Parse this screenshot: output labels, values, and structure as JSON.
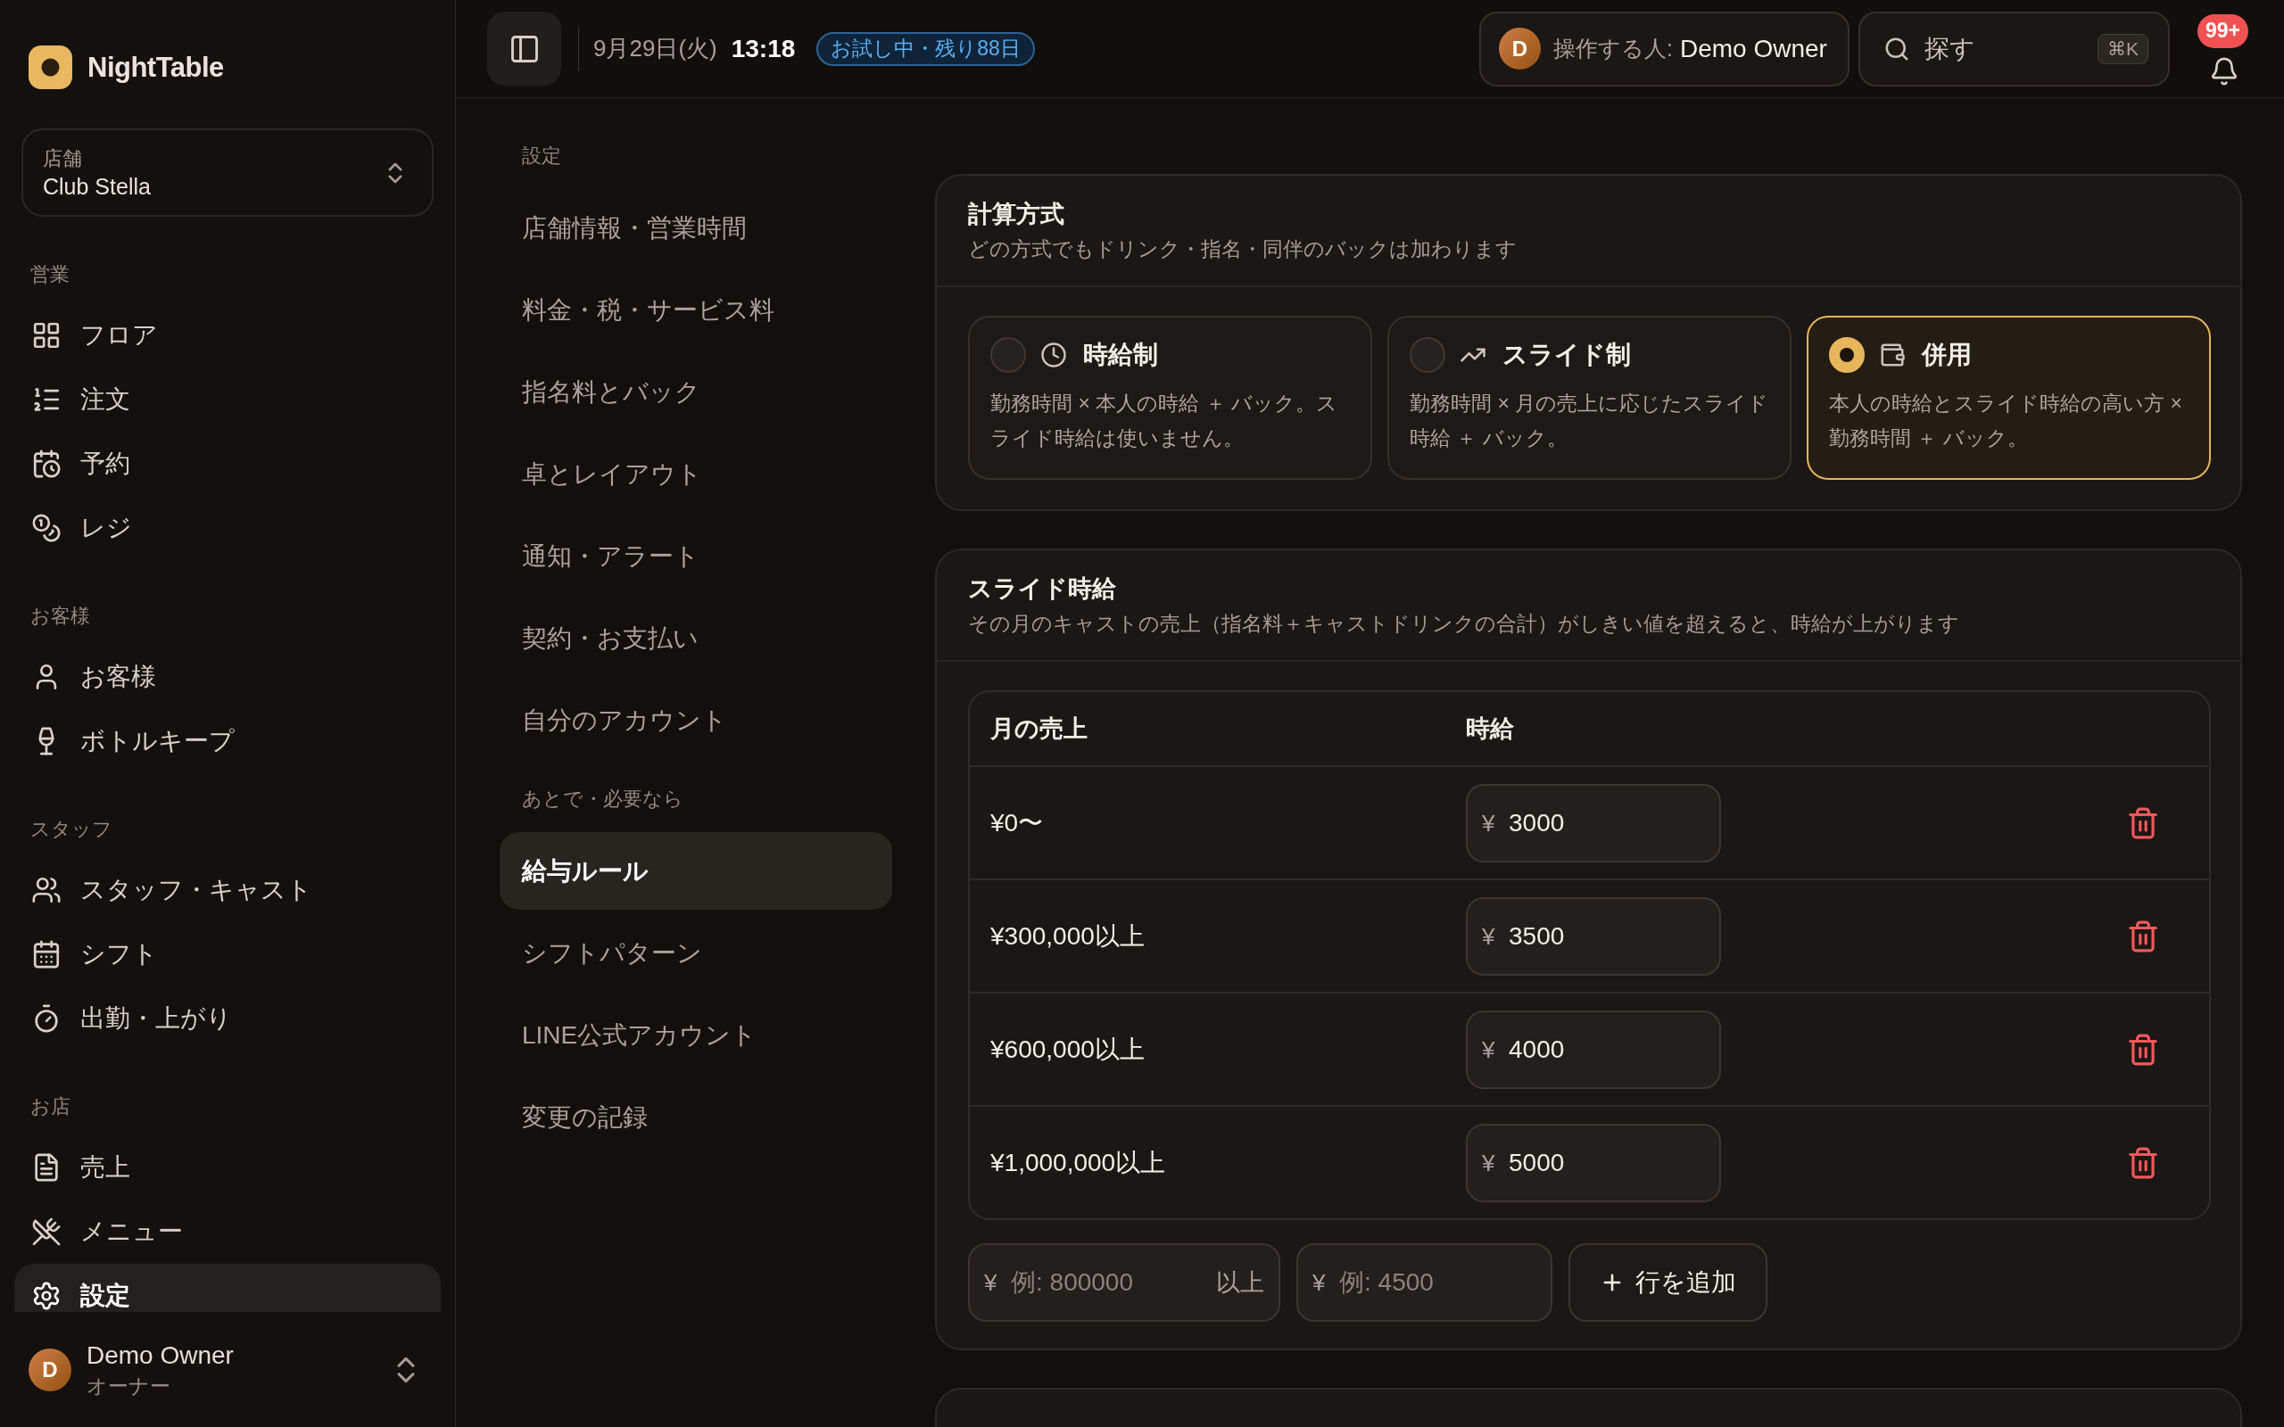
{
  "app": {
    "name": "NightTable"
  },
  "store_selector": {
    "label": "店舗",
    "value": "Club Stella"
  },
  "sidebar": {
    "sections": [
      {
        "title": "営業",
        "items": [
          {
            "label": "フロア",
            "selected": false
          },
          {
            "label": "注文",
            "selected": false
          },
          {
            "label": "予約",
            "selected": false
          },
          {
            "label": "レジ",
            "selected": false
          }
        ]
      },
      {
        "title": "お客様",
        "items": [
          {
            "label": "お客様",
            "selected": false
          },
          {
            "label": "ボトルキープ",
            "selected": false
          }
        ]
      },
      {
        "title": "スタッフ",
        "items": [
          {
            "label": "スタッフ・キャスト",
            "selected": false
          },
          {
            "label": "シフト",
            "selected": false
          },
          {
            "label": "出勤・上がり",
            "selected": false
          }
        ]
      },
      {
        "title": "お店",
        "items": [
          {
            "label": "売上",
            "selected": false
          },
          {
            "label": "メニュー",
            "selected": false
          },
          {
            "label": "設定",
            "selected": true
          }
        ]
      }
    ]
  },
  "user": {
    "initial": "D",
    "name": "Demo Owner",
    "role": "オーナー"
  },
  "header": {
    "date": "9月29日(火)",
    "time": "13:18",
    "trial_badge": "お試し中・残り88日",
    "operator": {
      "initial": "D",
      "label": "操作する人:",
      "name": "Demo Owner"
    },
    "search": {
      "label": "探す",
      "shortcut": "⌘K"
    },
    "notifications": {
      "count": "99+"
    }
  },
  "settings_nav": {
    "groups": [
      {
        "title": "設定",
        "items": [
          {
            "label": "店舗情報・営業時間",
            "selected": false
          },
          {
            "label": "料金・税・サービス料",
            "selected": false
          },
          {
            "label": "指名料とバック",
            "selected": false
          },
          {
            "label": "卓とレイアウト",
            "selected": false
          },
          {
            "label": "通知・アラート",
            "selected": false
          },
          {
            "label": "契約・お支払い",
            "selected": false
          },
          {
            "label": "自分のアカウント",
            "selected": false
          }
        ]
      },
      {
        "title": "あとで・必要なら",
        "items": [
          {
            "label": "給与ルール",
            "selected": true
          },
          {
            "label": "シフトパターン",
            "selected": false
          },
          {
            "label": "LINE公式アカウント",
            "selected": false
          },
          {
            "label": "変更の記録",
            "selected": false
          }
        ]
      }
    ]
  },
  "calc_method": {
    "title": "計算方式",
    "subtitle": "どの方式でもドリンク・指名・同伴のバックは加わります",
    "options": [
      {
        "title": "時給制",
        "description": "勤務時間 × 本人の時給 ＋ バック。スライド時給は使いません。",
        "selected": false
      },
      {
        "title": "スライド制",
        "description": "勤務時間 × 月の売上に応じたスライド時給 ＋ バック。",
        "selected": false
      },
      {
        "title": "併用",
        "description": "本人の時給とスライド時給の高い方 × 勤務時間 ＋ バック。",
        "selected": true
      }
    ]
  },
  "slide_wage": {
    "title": "スライド時給",
    "subtitle": "その月のキャストの売上（指名料＋キャストドリンクの合計）がしきい値を超えると、時給が上がります",
    "columns": [
      "月の売上",
      "時給"
    ],
    "rows": [
      {
        "threshold": "¥0〜",
        "currency": "¥",
        "wage": "3000"
      },
      {
        "threshold": "¥300,000以上",
        "currency": "¥",
        "wage": "3500"
      },
      {
        "threshold": "¥600,000以上",
        "currency": "¥",
        "wage": "4000"
      },
      {
        "threshold": "¥1,000,000以上",
        "currency": "¥",
        "wage": "5000"
      }
    ],
    "new_row": {
      "threshold_currency": "¥",
      "threshold_placeholder": "例: 800000",
      "threshold_suffix": "以上",
      "wage_currency": "¥",
      "wage_placeholder": "例: 4500",
      "add_label": "行を追加"
    }
  }
}
